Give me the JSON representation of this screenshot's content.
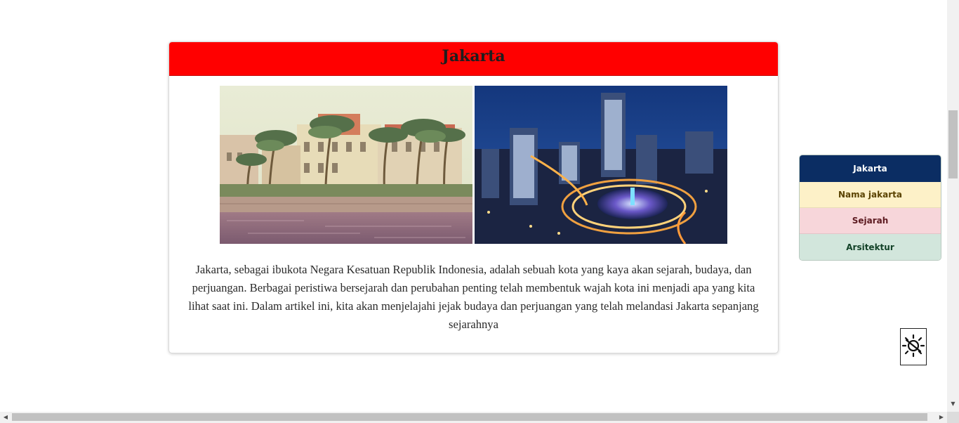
{
  "article": {
    "title": "Jakarta",
    "body": "Jakarta, sebagai ibukota Negara Kesatuan Republik Indonesia, adalah sebuah kota yang kaya akan sejarah, budaya, dan perjuangan. Berbagai peristiwa bersejarah dan perubahan penting telah membentuk wajah kota ini menjadi apa yang kita lihat saat ini. Dalam artikel ini, kita akan menjelajahi jejak budaya dan perjuangan yang telah melandasi Jakarta sepanjang sejarahnya",
    "header_color": "#ff0000"
  },
  "sidenav": {
    "items": [
      {
        "label": "Jakarta"
      },
      {
        "label": "Nama jakarta"
      },
      {
        "label": "Sejarah"
      },
      {
        "label": "Arsitektur"
      }
    ]
  },
  "theme_toggle": {
    "icon": "sun-moon-icon"
  },
  "scrollbars": {
    "vertical_position": 0.27,
    "horizontal_position": 0.0
  }
}
